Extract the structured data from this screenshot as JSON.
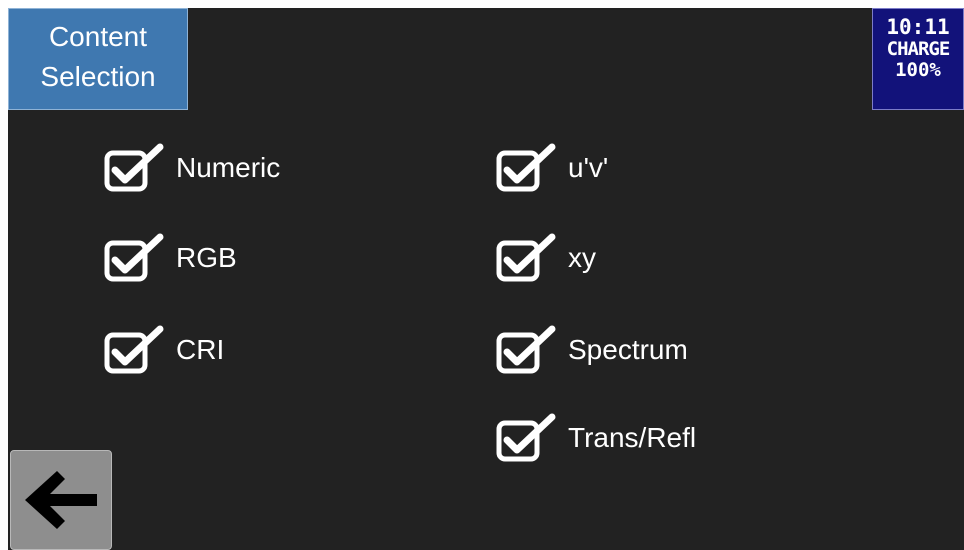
{
  "header": {
    "title_line1": "Content",
    "title_line2": "Selection"
  },
  "status": {
    "time": "10:11",
    "charge_label": "CHARGE",
    "charge_pct": "100%"
  },
  "options": {
    "numeric": {
      "label": "Numeric",
      "checked": true
    },
    "rgb": {
      "label": "RGB",
      "checked": true
    },
    "cri": {
      "label": "CRI",
      "checked": true
    },
    "uv": {
      "label": "u'v'",
      "checked": true
    },
    "xy": {
      "label": "xy",
      "checked": true
    },
    "spectrum": {
      "label": "Spectrum",
      "checked": true
    },
    "trans_refl": {
      "label": "Trans/Refl",
      "checked": true
    }
  },
  "icons": {
    "checkbox": "checkbox-checked-icon",
    "back": "arrow-left-icon"
  },
  "colors": {
    "background": "#222222",
    "title_bg": "#3f78b0",
    "status_bg": "#12127a",
    "back_button_bg": "#8e8e8e"
  }
}
